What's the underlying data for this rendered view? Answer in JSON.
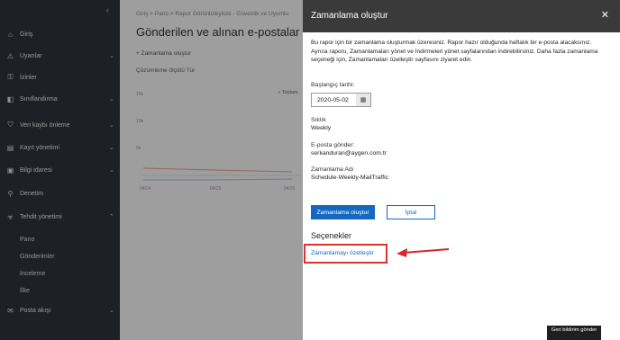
{
  "nav": {
    "items": [
      {
        "label": "Giriş",
        "icon": "home-icon",
        "chevron": false,
        "top": 26
      },
      {
        "label": "Uyarılar",
        "icon": "alert-icon",
        "chevron": true,
        "top": 50
      },
      {
        "label": "İzinler",
        "icon": "permissions-icon",
        "chevron": false,
        "top": 74
      },
      {
        "label": "Sınıflandırma",
        "icon": "classification-icon",
        "chevron": true,
        "top": 98
      },
      {
        "label": "Veri kaybı önleme",
        "icon": "dlp-icon",
        "chevron": true,
        "top": 127
      },
      {
        "label": "Kayıt yönetimi",
        "icon": "records-icon",
        "chevron": true,
        "top": 152
      },
      {
        "label": "Bilgi idaresi",
        "icon": "governance-icon",
        "chevron": true,
        "top": 177
      },
      {
        "label": "Denetim",
        "icon": "audit-icon",
        "chevron": false,
        "top": 203
      },
      {
        "label": "Tehdit yönetimi",
        "icon": "threat-icon",
        "chevron": true,
        "top": 229
      }
    ],
    "sub_items": [
      "Pano",
      "Gönderimler",
      "İnceleme",
      "İlke"
    ],
    "bottom_item": {
      "label": "Posta akışı",
      "icon": "mail-icon"
    }
  },
  "main": {
    "breadcrumb": "Giriş  >  Pano  >  Rapor Görüntüleyicisi - Güvenlik ve Uyumlu",
    "title": "Gönderilen ve alınan e-postalar ra",
    "create_label": "+ Zamanlama oluştur",
    "filter_label": "Çözümleme ölçütü  Tür",
    "legend_label": "Toplam",
    "y_ticks": [
      "15k",
      "10k",
      "5k"
    ],
    "x_ticks": [
      "04/24",
      "04/25",
      "04/26"
    ]
  },
  "panel": {
    "title": "Zamanlama oluştur",
    "description": "Bu rapor için bir zamanlama oluşturmak üzeresiniz. Rapor hazır olduğunda haftalık bir e-posta alacaksınız. Ayrıca raporu, Zamanlamaları yönet ve İndirmeleri yönet sayfalarından indirebilirsiniz. Daha fazla zamanlama seçeneği için, Zamanlamaları özelleştir sayfasını ziyaret edin.",
    "start_date_label": "Başlangıç tarihi:",
    "start_date_value": "2020-05-02",
    "frequency_label": "Sıklık",
    "frequency_value": "Weekly",
    "email_label": "E-posta gönder:",
    "email_value": "serkanduran@aygen.com.tr",
    "schedule_name_label": "Zamanlama Adı",
    "schedule_name_value": "Schedule-Weekly-MailTraffic",
    "create_button": "Zamanlama oluştur",
    "cancel_button": "İptal",
    "options_title": "Seçenekler",
    "customize_link": "Zamanlamayı özelleştir"
  },
  "feedback_button": "Geri bildirim gönder",
  "colors": {
    "nav_bg": "#2f3640",
    "panel_header": "#3a3a3a",
    "primary": "#1568c2",
    "highlight": "#e03131"
  }
}
